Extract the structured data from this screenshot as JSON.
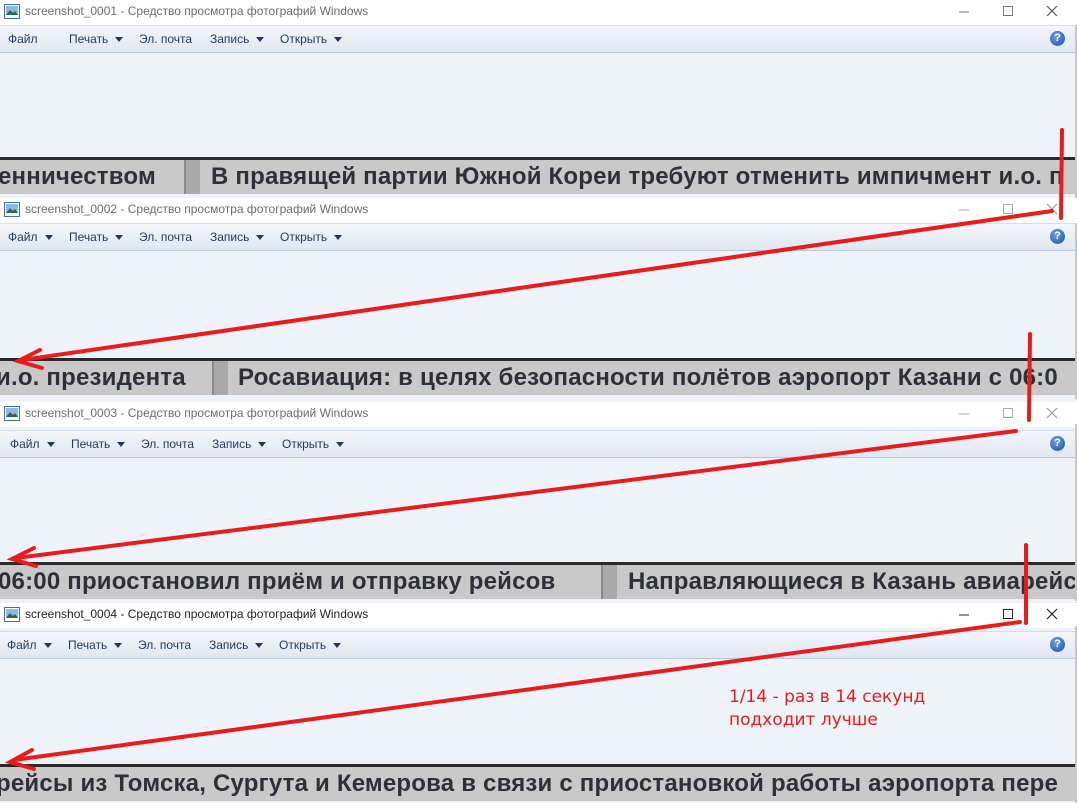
{
  "windows": [
    {
      "title": "screenshot_0001 - Средство просмотра фотографий Windows",
      "menu": [
        "Файл",
        "Печать",
        "Эл. почта",
        "Запись",
        "Открыть"
      ],
      "ticker": [
        "енничеством",
        "В правящей партии Южной Кореи требуют отменить импичмент и.о. п"
      ]
    },
    {
      "title": "screenshot_0002 - Средство просмотра фотографий Windows",
      "menu": [
        "Файл",
        "Печать",
        "Эл. почта",
        "Запись",
        "Открыть"
      ],
      "ticker": [
        "и.о. президента",
        "Росавиация: в целях безопасности полётов аэропорт Казани с 06:0"
      ]
    },
    {
      "title": "screenshot_0003 - Средство просмотра фотографий Windows",
      "menu": [
        "Файл",
        "Печать",
        "Эл. почта",
        "Запись",
        "Открыть"
      ],
      "ticker": [
        "06:00 приостановил приём и отправку рейсов",
        "Направляющиеся в Казань авиарейс"
      ]
    },
    {
      "title": "screenshot_0004 - Средство просмотра фотографий Windows",
      "menu": [
        "Файл",
        "Печать",
        "Эл. почта",
        "Запись",
        "Открыть"
      ],
      "ticker": [
        "рейсы из Томска, Сургута и Кемерова в связи с приостановкой работы аэропорта пере"
      ]
    }
  ],
  "help_icon": "?",
  "annotation": {
    "line1": "1/14 - раз в 14 секунд",
    "line2": "подходит лучше",
    "color": "#e31b1b"
  },
  "icons": [
    "photo-viewer-app-icon",
    "minimize-icon",
    "maximize-icon",
    "close-icon",
    "help-icon",
    "dropdown-arrow-icon"
  ]
}
